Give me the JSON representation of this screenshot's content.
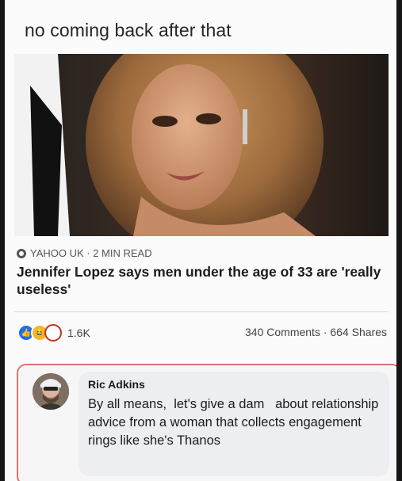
{
  "post": {
    "caption": "no coming back after that"
  },
  "article": {
    "source_line": "YAHOO UK · 2 MIN READ",
    "headline": "Jennifer Lopez says men under the age of 33 are 'really useless'"
  },
  "engagement": {
    "reaction_count": "1.6K",
    "comments_shares": "340 Comments · 664 Shares"
  },
  "comment": {
    "author": "Ric Adkins",
    "text": "By all means,  let's give a dam   about relationship advice from a woman that collects engagement rings like she's Thanos"
  },
  "colors": {
    "like": "#1f6feb",
    "haha": "#f2b824",
    "highlight_border": "#d4766e"
  },
  "icons": {
    "source": "globe-icon",
    "reactions": [
      "like-icon",
      "haha-icon",
      "wow-icon"
    ]
  }
}
